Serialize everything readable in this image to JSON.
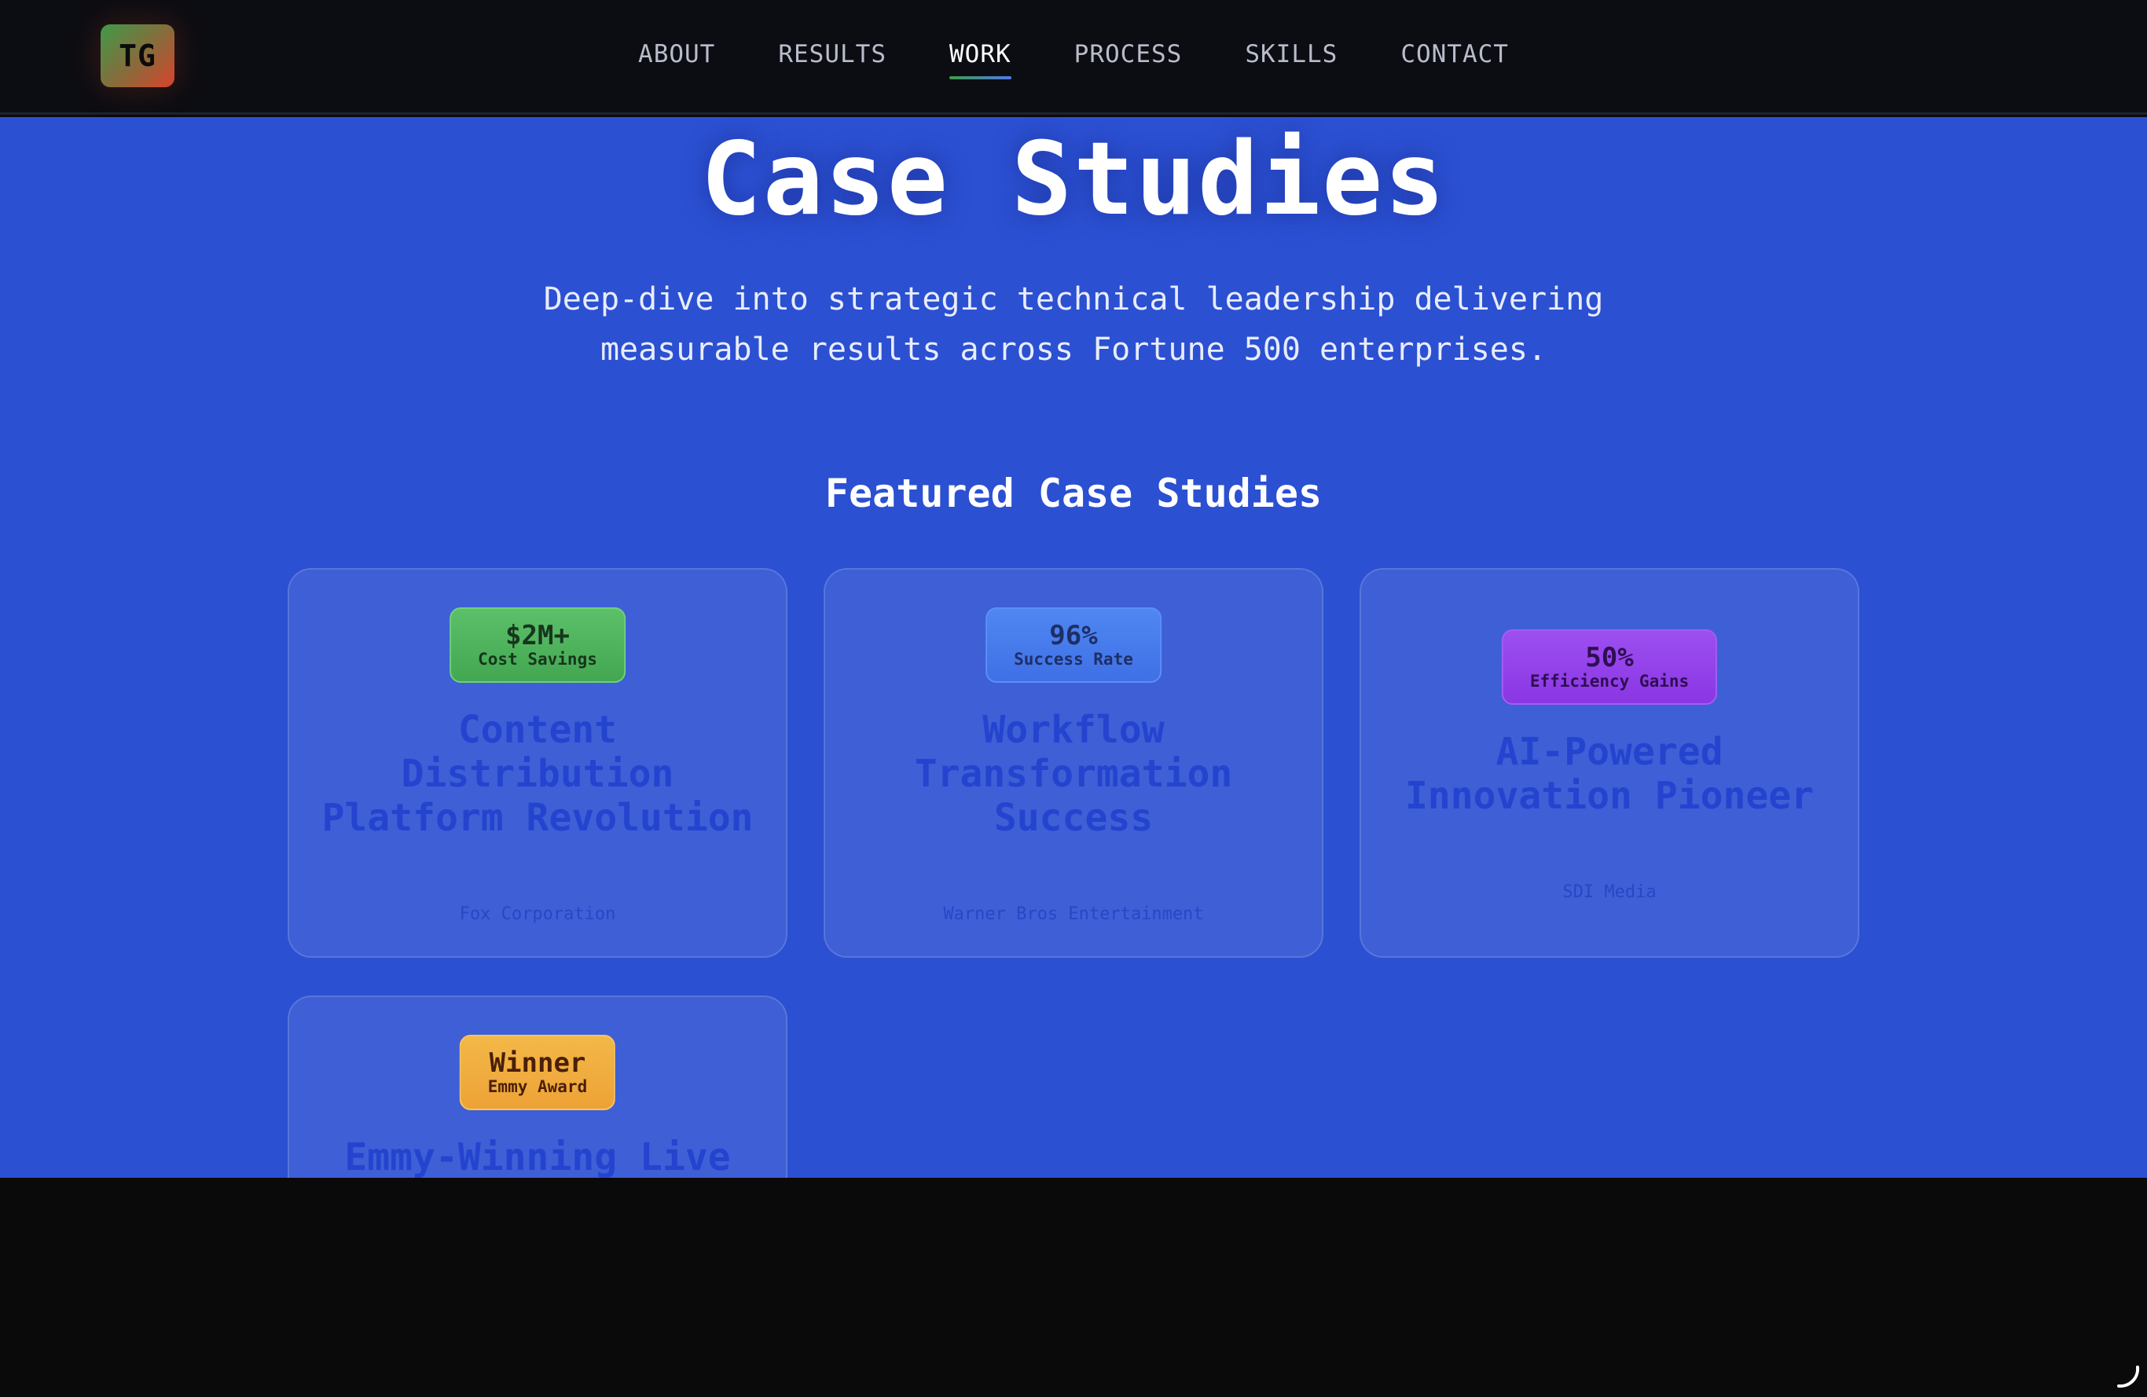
{
  "logo": {
    "text": "TG"
  },
  "nav": {
    "items": [
      {
        "label": "ABOUT"
      },
      {
        "label": "RESULTS"
      },
      {
        "label": "WORK"
      },
      {
        "label": "PROCESS"
      },
      {
        "label": "SKILLS"
      },
      {
        "label": "CONTACT"
      }
    ],
    "active": "WORK"
  },
  "hero": {
    "title": "Case Studies",
    "subtitle_line1": "Deep-dive into strategic technical leadership delivering",
    "subtitle_line2": "measurable results across Fortune 500 enterprises."
  },
  "featured": {
    "heading": "Featured Case Studies",
    "cards": [
      {
        "badge_value": "$2M+",
        "badge_label": "Cost Savings",
        "badge_color": "#4fb55e",
        "title_lines": [
          "Content",
          "Distribution",
          "Platform Revolution"
        ],
        "client": "Fox Corporation"
      },
      {
        "badge_value": "96%",
        "badge_label": "Success Rate",
        "badge_color": "#4a7ff0",
        "title_lines": [
          "Workflow",
          "Transformation",
          "Success"
        ],
        "client": "Warner Bros Entertainment"
      },
      {
        "badge_value": "50%",
        "badge_label": "Efficiency Gains",
        "badge_color": "#9444ea",
        "title_lines": [
          "AI-Powered",
          "Innovation Pioneer"
        ],
        "client": "SDI Media"
      },
      {
        "badge_value": "Winner",
        "badge_label": "Emmy Award",
        "badge_color": "#f1ad3f",
        "title_lines": [
          "Emmy-Winning Live"
        ],
        "client": ""
      }
    ]
  },
  "colors": {
    "nav_bg": "#0c0d12",
    "content_bg": "#2b50d2",
    "card_title": "#2444cf",
    "footer_bg": "#0a0a0a"
  }
}
